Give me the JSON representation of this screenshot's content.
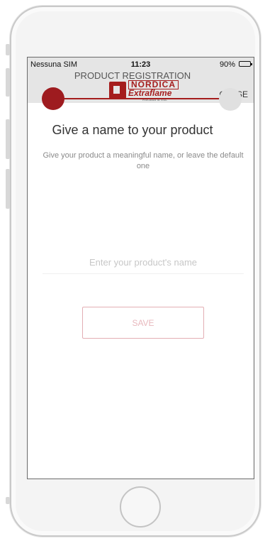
{
  "status_bar": {
    "carrier": "Nessuna SIM",
    "time": "11:23",
    "battery": "90%"
  },
  "header": {
    "logo_brand": "NORDICA",
    "logo_sub": "Extraflame",
    "logo_tagline": "Riscalda la vita.",
    "close_label": "CLOSE"
  },
  "stepper": {
    "title": "PRODUCT REGISTRATION",
    "active_color": "#9e1b1f",
    "inactive_color": "#e0e0e0"
  },
  "content": {
    "heading": "Give a name to your product",
    "subtext": "Give your product a meaningful name, or leave the default one",
    "input_placeholder": "Enter your product's name",
    "input_value": "",
    "save_label": "SAVE"
  },
  "colors": {
    "brand": "#a51d1d",
    "nav_background": "#e5e5e5"
  }
}
